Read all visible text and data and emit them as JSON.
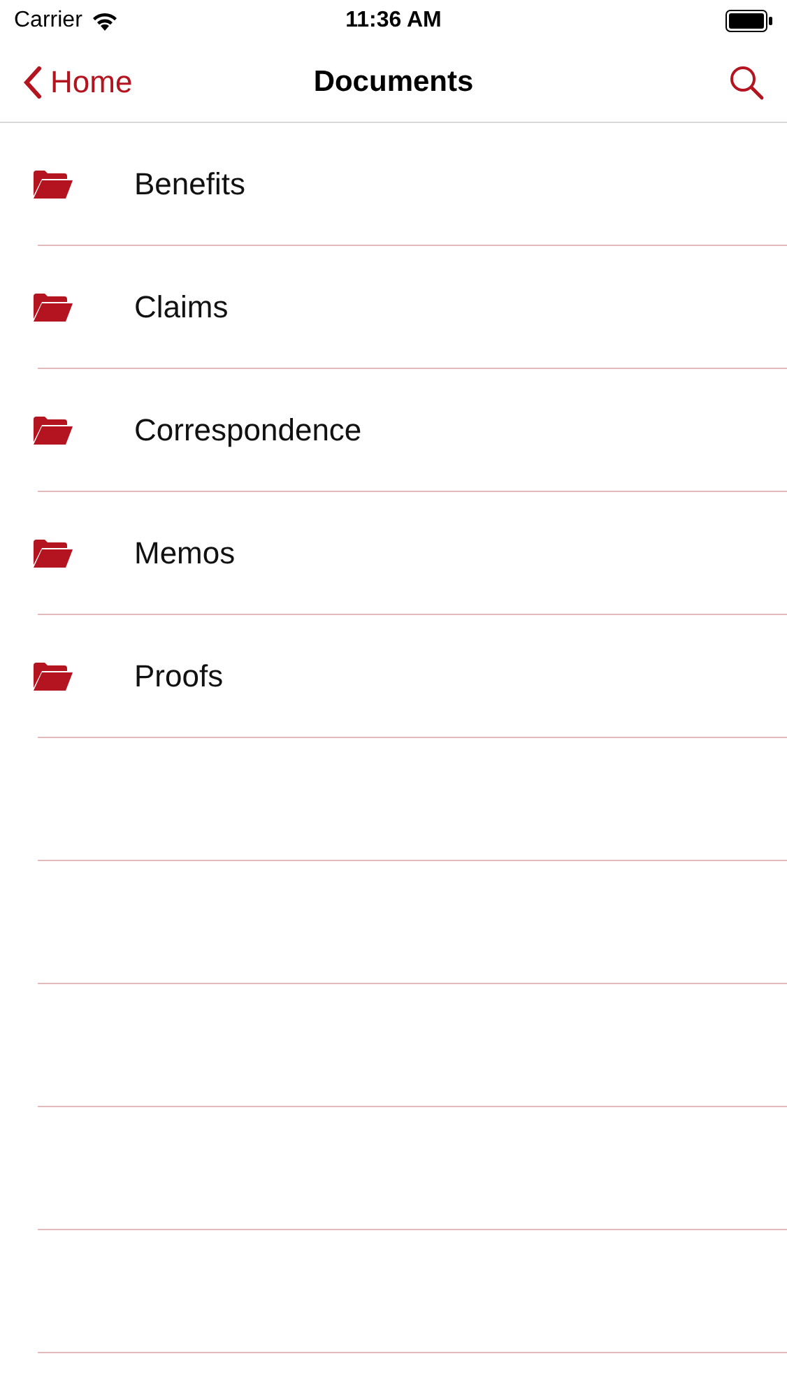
{
  "status_bar": {
    "carrier": "Carrier",
    "time": "11:36 AM"
  },
  "nav": {
    "back": "Home",
    "title": "Documents"
  },
  "folders": [
    {
      "name": "Benefits"
    },
    {
      "name": "Claims"
    },
    {
      "name": "Correspondence"
    },
    {
      "name": "Memos"
    },
    {
      "name": "Proofs"
    }
  ]
}
